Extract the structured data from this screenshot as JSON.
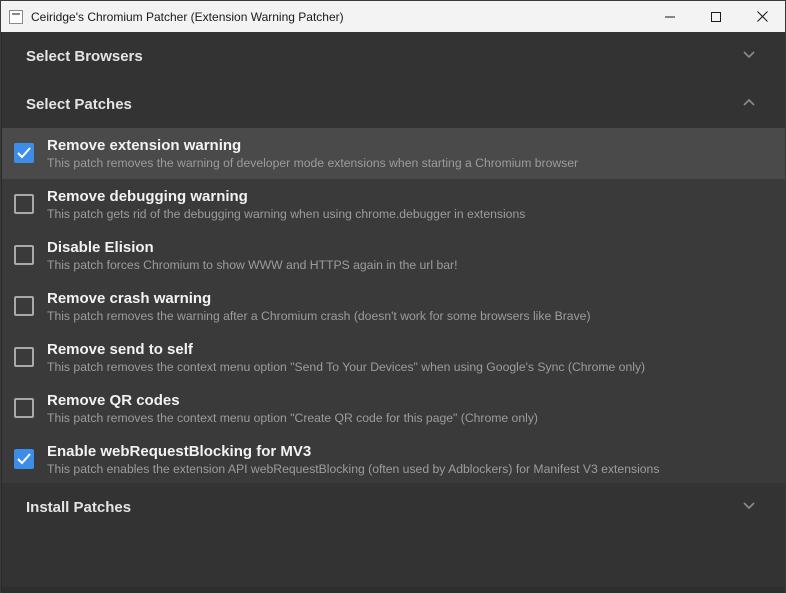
{
  "window": {
    "title": "Ceiridge's Chromium Patcher (Extension Warning Patcher)",
    "controls": [
      "minimize-icon",
      "maximize-icon",
      "close-icon"
    ]
  },
  "sections": {
    "select_browsers": {
      "label": "Select Browsers",
      "expanded": false
    },
    "select_patches": {
      "label": "Select Patches",
      "expanded": true
    },
    "install_patches": {
      "label": "Install Patches",
      "expanded": false
    }
  },
  "patches": [
    {
      "title": "Remove extension warning",
      "description": "This patch removes the warning of developer mode extensions when starting a Chromium browser",
      "checked": true
    },
    {
      "title": "Remove debugging warning",
      "description": "This patch gets rid of the debugging warning when using chrome.debugger in extensions",
      "checked": false
    },
    {
      "title": "Disable Elision",
      "description": "This patch forces Chromium to show WWW and HTTPS again in the url bar!",
      "checked": false
    },
    {
      "title": "Remove crash warning",
      "description": "This patch removes the warning after a Chromium crash (doesn't work for some browsers like Brave)",
      "checked": false
    },
    {
      "title": "Remove send to self",
      "description": "This patch removes the context menu option \"Send To Your Devices\" when using Google's Sync (Chrome only)",
      "checked": false
    },
    {
      "title": "Remove QR codes",
      "description": "This patch removes the context menu option \"Create QR code for this page\" (Chrome only)",
      "checked": false
    },
    {
      "title": "Enable webRequestBlocking for MV3",
      "description": "This patch enables the extension API webRequestBlocking (often used by Adblockers) for Manifest V3 extensions",
      "checked": true
    }
  ],
  "colors": {
    "accent": "#3b8de8",
    "background": "#333333",
    "row_background": "#3a3a3a",
    "selected_row": "#4a4a4a"
  }
}
